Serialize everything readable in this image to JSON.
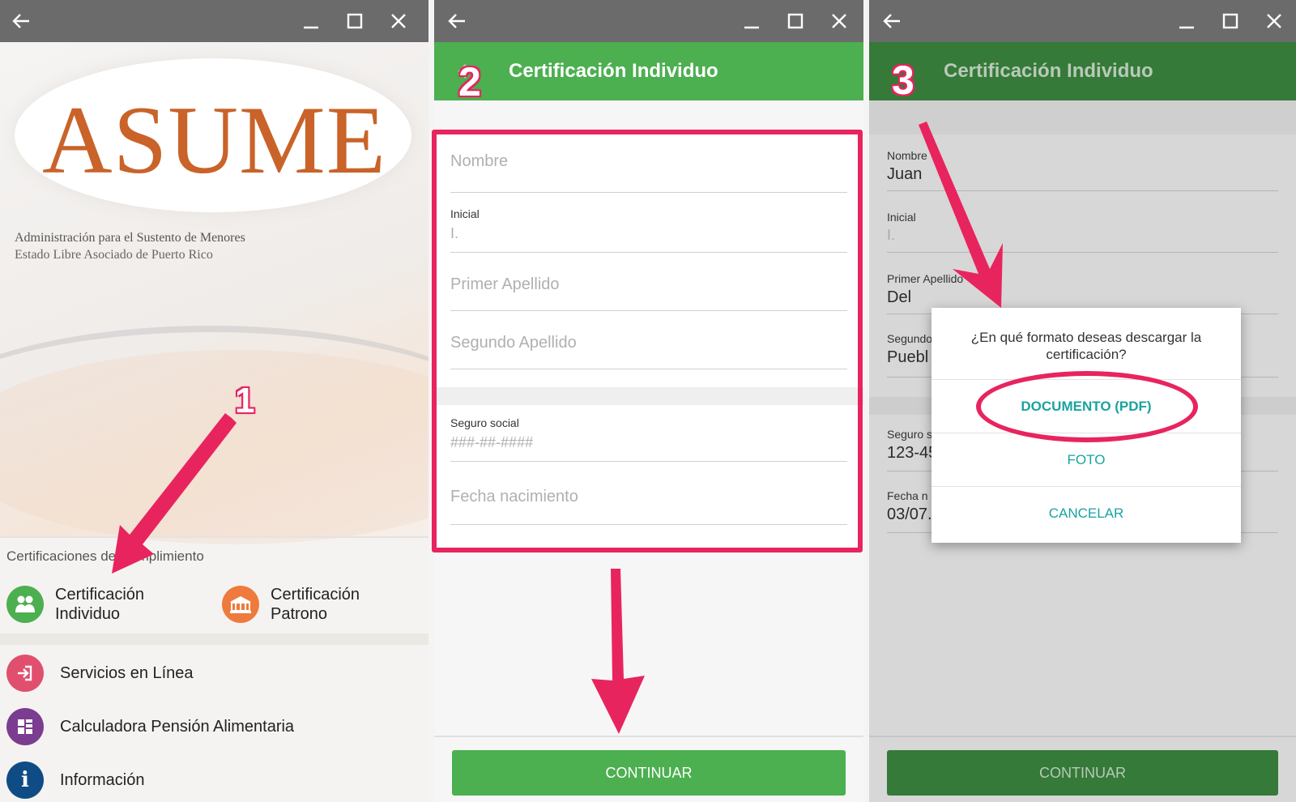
{
  "panel1": {
    "logo": "ASUME",
    "agency_line1": "Administración para el Sustento de Menores",
    "agency_line2": "Estado Libre Asociado de Puerto Rico",
    "section_label": "Certificaciones de Cumplimiento",
    "cert_individuo": "Certificación Individuo",
    "cert_patrono": "Certificación Patrono",
    "menu": [
      {
        "label": "Servicios en Línea",
        "color": "#e0506e"
      },
      {
        "label": "Calculadora Pensión Alimentaria",
        "color": "#7b3d8f"
      },
      {
        "label": "Información",
        "color": "#0f4c86"
      }
    ],
    "step": "1"
  },
  "panel2": {
    "title": "Certificación Individuo",
    "step": "2",
    "fields": {
      "nombre_placeholder": "Nombre",
      "inicial_label": "Inicial",
      "inicial_placeholder": "I.",
      "primer_apellido_placeholder": "Primer Apellido",
      "segundo_apellido_placeholder": "Segundo Apellido",
      "seguro_label": "Seguro social",
      "seguro_placeholder": "###-##-####",
      "fecha_placeholder": "Fecha nacimiento"
    },
    "continue_label": "CONTINUAR"
  },
  "panel3": {
    "title": "Certificación Individuo",
    "step": "3",
    "fields": {
      "nombre_label": "Nombre",
      "nombre_value": "Juan",
      "inicial_label": "Inicial",
      "inicial_value": "I.",
      "primer_label": "Primer Apellido",
      "primer_value": "Del",
      "segundo_label": "Segundo",
      "segundo_value": "Puebl",
      "seguro_label": "Seguro s",
      "seguro_value": "123-45",
      "fecha_label": "Fecha n",
      "fecha_value": "03/07."
    },
    "dialog": {
      "question": "¿En qué formato deseas descargar la certificación?",
      "option_pdf": "DOCUMENTO (PDF)",
      "option_foto": "FOTO",
      "option_cancel": "CANCELAR"
    },
    "continue_label": "CONTINUAR"
  },
  "colors": {
    "titlebar": "#6b6b6b",
    "green": "#4caf50",
    "green_dark": "#357a38",
    "accent_teal": "#1aa3a0",
    "annotation": "#e8245e",
    "logo": "#c9632a"
  },
  "icons": [
    "back-arrow-icon",
    "minimize-icon",
    "maximize-icon",
    "close-icon",
    "people-icon",
    "building-icon",
    "login-icon",
    "calculator-icon",
    "info-icon"
  ]
}
